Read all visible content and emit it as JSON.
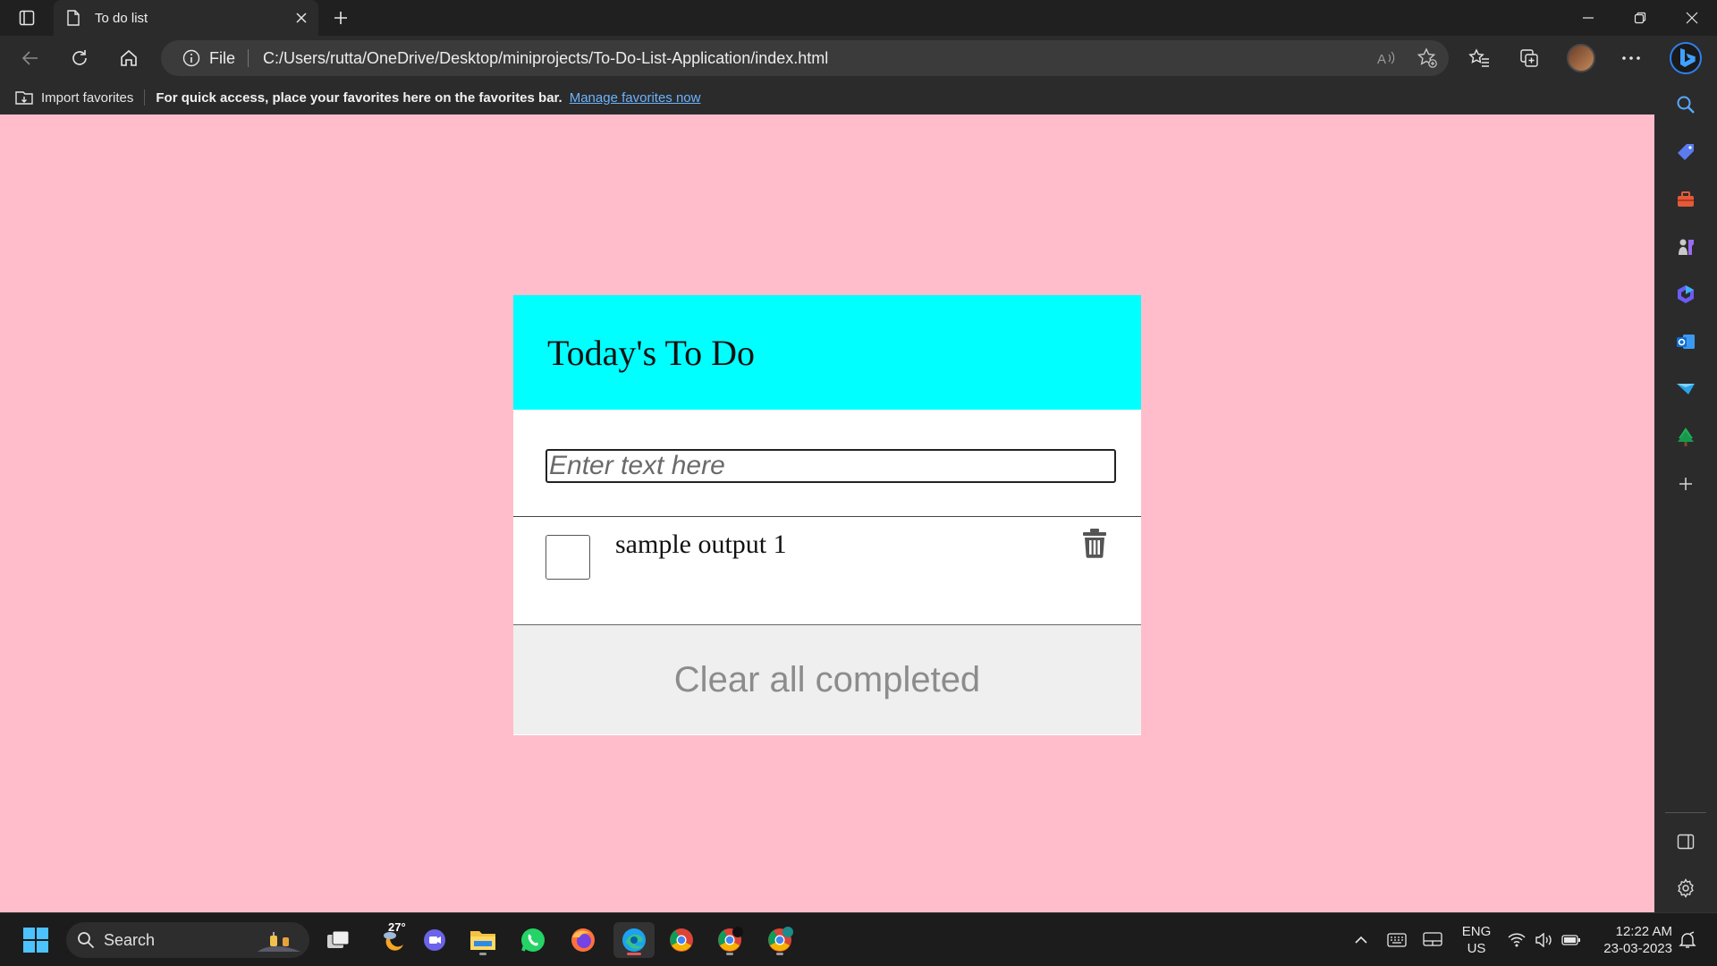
{
  "browser": {
    "tab": {
      "title": "To do list"
    },
    "address": {
      "protocol": "File",
      "url": "C:/Users/rutta/OneDrive/Desktop/miniprojects/To-Do-List-Application/index.html"
    },
    "favorites_bar": {
      "import_label": "Import favorites",
      "hint": "For quick access, place your favorites here on the favorites bar.",
      "manage_link": "Manage favorites now"
    }
  },
  "app": {
    "title": "Today's To Do",
    "input_placeholder": "Enter text here",
    "items": [
      {
        "text": "sample output 1",
        "completed": false
      }
    ],
    "clear_button": "Clear all completed",
    "colors": {
      "background": "#ffbdcb",
      "header": "#00ffff",
      "footer": "#efefef"
    }
  },
  "taskbar": {
    "search_label": "Search",
    "weather_temp": "27°",
    "language": {
      "line1": "ENG",
      "line2": "US"
    },
    "time": "12:22 AM",
    "date": "23-03-2023"
  },
  "sidebar_icons": [
    "search-icon",
    "shopping-tag-icon",
    "tools-icon",
    "games-icon",
    "office-icon",
    "outlook-icon",
    "telegram-icon",
    "tree-icon",
    "add-icon",
    "sidebar-toggle-icon",
    "settings-icon"
  ]
}
